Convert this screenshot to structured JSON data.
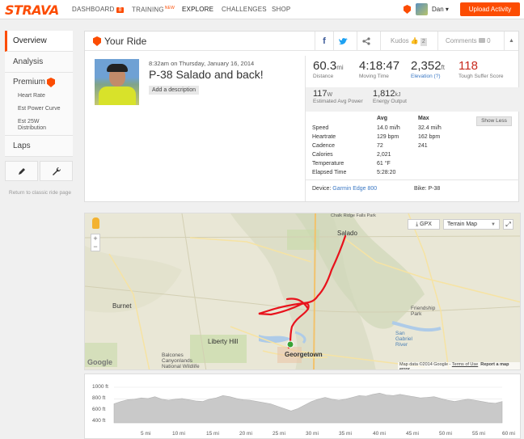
{
  "nav": {
    "logo": "STRAVA",
    "dashboard": "DASHBOARD",
    "dashboard_badge": "8",
    "training": "TRAINING",
    "training_new": "NEW",
    "explore": "EXPLORE",
    "challenges": "CHALLENGES",
    "shop": "SHOP",
    "user": "Dan",
    "user_caret": "▾",
    "upload": "Upload Activity",
    "accent": "#fc4c02"
  },
  "sidebar": {
    "overview": "Overview",
    "analysis": "Analysis",
    "premium": "Premium",
    "premium_items": [
      "Heart Rate",
      "Est Power Curve",
      "Est 25W Distribution"
    ],
    "laps": "Laps",
    "return_link": "Return to classic ride page",
    "tool_icons": [
      "pencil-icon",
      "wrench-icon"
    ]
  },
  "ride": {
    "header": "Your Ride",
    "facebook": "f",
    "kudos_label": "Kudos",
    "kudos_count": "2",
    "comments_label": "Comments",
    "comments_count": "0",
    "collapse": "▲",
    "date": "8:32am on Thursday, January 16, 2014",
    "name": "P-38 Salado and back!",
    "add_description": "Add a description",
    "stats": {
      "distance": {
        "value": "60.3",
        "unit": "mi",
        "label": "Distance"
      },
      "moving_time": {
        "value": "4:18:47",
        "label": "Moving Time"
      },
      "elevation": {
        "value": "2,352",
        "unit": "ft",
        "label": "Elevation (?)"
      },
      "suffer": {
        "value": "118",
        "label": "Tough Suffer Score"
      },
      "power": {
        "value": "117",
        "unit": "W",
        "label": "Estimated Avg Power"
      },
      "energy": {
        "value": "1,812",
        "unit": "kJ",
        "label": "Energy Output"
      }
    },
    "show_less": "Show Less",
    "table_headers": {
      "avg": "Avg",
      "max": "Max"
    },
    "table": [
      {
        "label": "Speed",
        "avg": "14.0 mi/h",
        "max": "32.4 mi/h"
      },
      {
        "label": "Heartrate",
        "avg": "129 bpm",
        "max": "162 bpm"
      },
      {
        "label": "Cadence",
        "avg": "72",
        "max": "241"
      },
      {
        "label": "Calories",
        "avg": "2,021",
        "max": ""
      },
      {
        "label": "Temperature",
        "avg": "61 °F",
        "max": ""
      },
      {
        "label": "Elapsed Time",
        "avg": "5:28:20",
        "max": ""
      }
    ],
    "device_label": "Device:",
    "device": "Garmin Edge 800",
    "bike": "Bike: P-38"
  },
  "map": {
    "gpx": "GPX",
    "map_type": "Terrain Map",
    "data_credit": "Map data ©2014 Google",
    "terms": "Terms of Use",
    "report": "Report a map error",
    "google": "Google",
    "labels": {
      "salado": "Salado",
      "georgetown": "Georgetown",
      "burnet": "Burnet",
      "liberty_hill": "Liberty Hill",
      "friendship_park": "Friendship Park",
      "san_gabriel": "San Gabriel River",
      "balcones": "Balcones Canyonlands National Wildlife",
      "chalk_ridge": "Chalk Ridge Falls Park"
    },
    "highways": [
      "183",
      "281",
      "29",
      "138",
      "190",
      "35",
      "195",
      "95",
      "130",
      "183",
      "29"
    ],
    "route_color": "#e8121c"
  },
  "elevation": {
    "y_labels": [
      "1000 ft",
      "800 ft",
      "600 ft",
      "400 ft"
    ],
    "x_labels": [
      "5 mi",
      "10 mi",
      "15 mi",
      "20 mi",
      "25 mi",
      "30 mi",
      "35 mi",
      "40 mi",
      "45 mi",
      "50 mi",
      "55 mi",
      "60 mi"
    ],
    "profile_ft": [
      720,
      760,
      790,
      800,
      820,
      810,
      840,
      800,
      780,
      800,
      810,
      790,
      770,
      760,
      800,
      820,
      860,
      840,
      810,
      790,
      780,
      760,
      740,
      720,
      680,
      640,
      600,
      640,
      700,
      760,
      800,
      830,
      800,
      780,
      800,
      830,
      860,
      850,
      880,
      900,
      870,
      860,
      880,
      860,
      840,
      820,
      830,
      840,
      810,
      780,
      760,
      780,
      800,
      780,
      760,
      740,
      730,
      760
    ]
  }
}
